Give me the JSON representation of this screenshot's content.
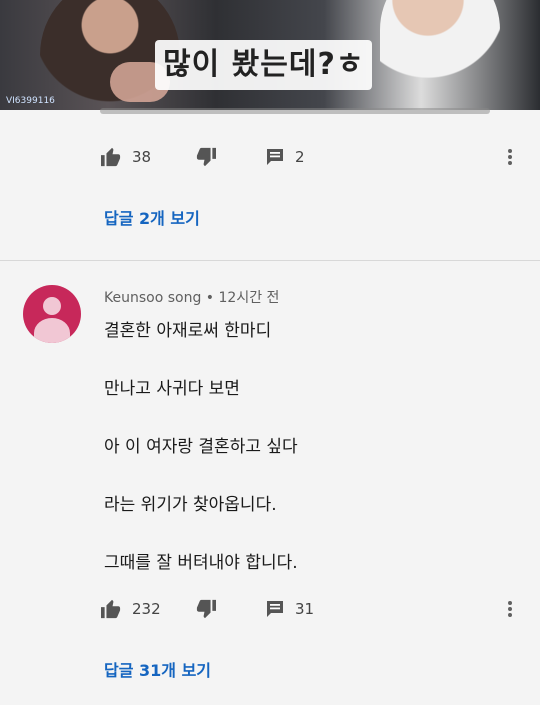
{
  "video": {
    "caption": "많이 봤는데?ㅎ",
    "watermark": "VI6399116"
  },
  "comment1": {
    "likes": "38",
    "replies_count": "2",
    "view_replies": "답글 2개 보기"
  },
  "comment2": {
    "author": "Keunsoo song",
    "time": "• 12시간 전",
    "lines": [
      "결혼한 아재로써 한마디",
      "만나고 사귀다 보면",
      "아 이 여자랑 결혼하고 싶다",
      "라는 위기가 찾아옵니다.",
      "그때를 잘 버텨내야 합니다."
    ],
    "likes": "232",
    "replies_count": "31",
    "view_replies": "답글 31개 보기"
  },
  "colors": {
    "link": "#1565c0",
    "avatar": "#c7285a",
    "background": "#f4f4f4"
  },
  "icons": [
    "thumb-up-icon",
    "thumb-down-icon",
    "reply-icon",
    "more-vert-icon"
  ]
}
